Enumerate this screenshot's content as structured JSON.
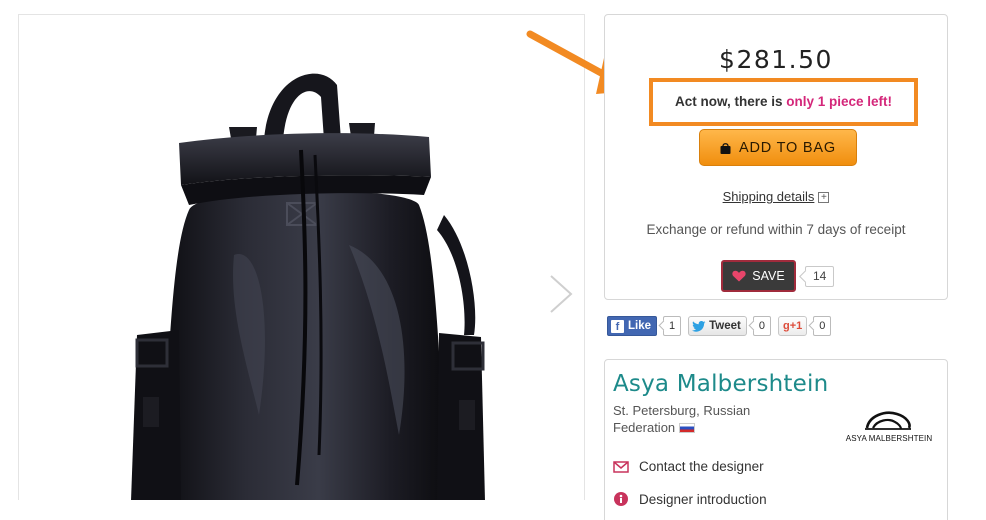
{
  "buy_box": {
    "price": "$281.50",
    "urgency_prefix": "Act now, there is ",
    "urgency_highlight": "only 1 piece left!",
    "add_to_bag_label": "ADD TO BAG",
    "shipping_link": "Shipping details",
    "shipping_toggle": "+",
    "exchange_text": "Exchange or refund within 7 days of receipt",
    "save_label": "SAVE",
    "save_count": "14"
  },
  "social": {
    "facebook_icon": "f",
    "facebook_label": "Like",
    "facebook_count": "1",
    "twitter_label": "Tweet",
    "twitter_count": "0",
    "gplus_label": "g+1",
    "gplus_count": "0"
  },
  "designer": {
    "name": "Asya Malbershtein",
    "location_line1": "St. Petersburg, Russian",
    "location_line2": "Federation",
    "brand_text": "ASYA MALBERSHTEIN",
    "links": [
      "Contact the designer",
      "Designer introduction"
    ]
  },
  "colors": {
    "accent_orange": "#f28a22",
    "highlight_pink": "#d4277a",
    "designer_teal": "#1d8a8a"
  },
  "icons": [
    "next-arrow-icon",
    "bag-icon",
    "plus-icon",
    "heart-icon",
    "facebook-icon",
    "twitter-icon",
    "mail-icon",
    "info-icon"
  ]
}
